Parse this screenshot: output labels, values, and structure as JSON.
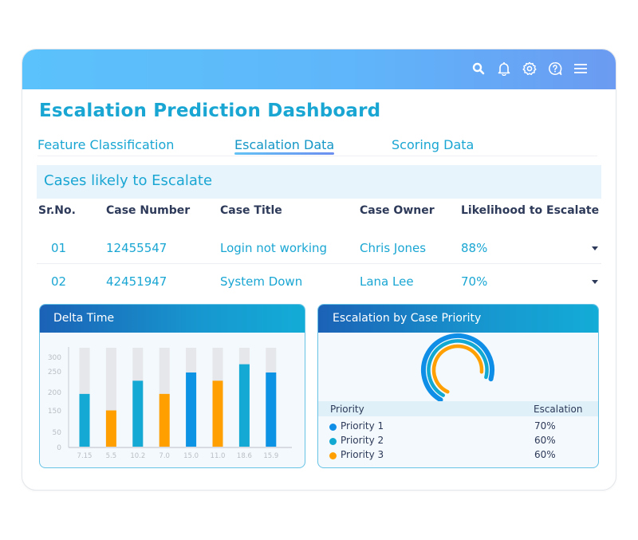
{
  "header": {
    "icons": [
      "search-icon",
      "bell-icon",
      "gear-icon",
      "help-icon",
      "menu-icon"
    ],
    "gradient_colors": [
      "#5bc2fb",
      "#6b9bf2"
    ]
  },
  "page_title": "Escalation Prediction Dashboard",
  "tabs": [
    {
      "label": "Feature Classification",
      "active": false
    },
    {
      "label": "Escalation Data",
      "active": true
    },
    {
      "label": "Scoring Data",
      "active": false
    }
  ],
  "cases": {
    "section_title": "Cases likely to Escalate",
    "columns": [
      "Sr.No.",
      "Case Number",
      "Case Title",
      "Case Owner",
      "Likelihood to Escalate"
    ],
    "rows": [
      {
        "sr": "01",
        "case_number": "12455547",
        "title": "Login not working",
        "owner": "Chris Jones",
        "likelihood": "88%"
      },
      {
        "sr": "02",
        "case_number": "42451947",
        "title": "System Down",
        "owner": "Lana Lee",
        "likelihood": "70%"
      }
    ]
  },
  "delta_panel": {
    "title": "Delta Time"
  },
  "priority_panel": {
    "title": "Escalation by Case Priority",
    "legend_headers": [
      "Priority",
      "Escalation"
    ],
    "items": [
      {
        "label": "Priority 1",
        "value": "70%",
        "color": "#0e8ee6"
      },
      {
        "label": "Priority 2",
        "value": "60%",
        "color": "#11a9d1"
      },
      {
        "label": "Priority 3",
        "value": "60%",
        "color": "#ffa000"
      }
    ]
  },
  "chart_data": [
    {
      "type": "bar",
      "title": "Delta Time",
      "categories": [
        "7.15",
        "5.5",
        "10.2",
        "7.0",
        "15.0",
        "11.0",
        "18.6",
        "15.9"
      ],
      "values": [
        160,
        110,
        200,
        160,
        225,
        200,
        250,
        225
      ],
      "bar_colors": [
        "#13a9d4",
        "#ffa000",
        "#13a9d4",
        "#ffa000",
        "#0d93e3",
        "#ffa000",
        "#13a9d4",
        "#0d93e3"
      ],
      "background_max": 300,
      "yticks": [
        "0",
        "50",
        "150",
        "200",
        "250",
        "300"
      ],
      "ytick_values": [
        0,
        50,
        150,
        200,
        250,
        300
      ],
      "xlabel": "",
      "ylabel": "",
      "ylim": [
        0,
        300
      ],
      "grid": false
    },
    {
      "type": "pie",
      "title": "Escalation by Case Priority",
      "style": "concentric-arcs",
      "categories": [
        "Priority 1",
        "Priority 2",
        "Priority 3"
      ],
      "values": [
        70,
        60,
        60
      ],
      "colors": [
        "#0e8ee6",
        "#11a9d1",
        "#ffa000"
      ],
      "unit": "%"
    }
  ]
}
